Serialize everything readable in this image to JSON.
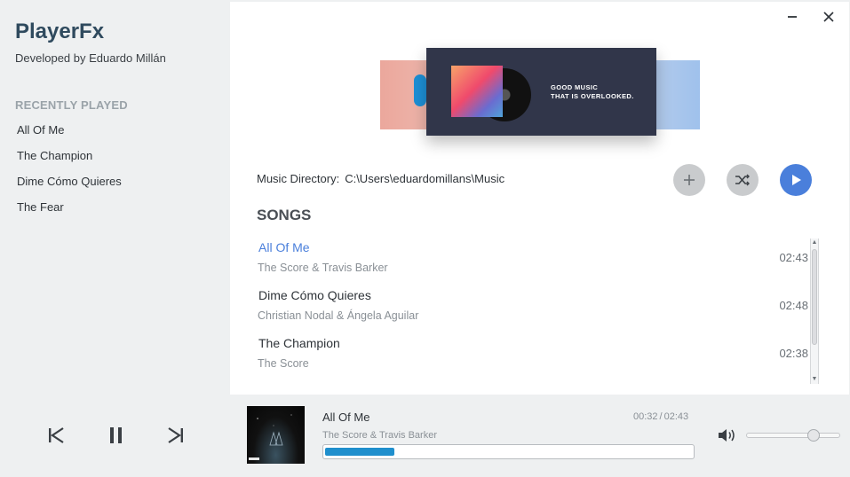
{
  "app": {
    "title": "PlayerFx",
    "subtitle": "Developed by Eduardo Millán"
  },
  "sidebar": {
    "heading": "RECENTLY PLAYED",
    "items": [
      {
        "label": "All Of Me"
      },
      {
        "label": "The Champion"
      },
      {
        "label": "Dime Cómo Quieres"
      },
      {
        "label": "The Fear"
      }
    ]
  },
  "window": {
    "minimize_icon": "minimize-icon",
    "close_icon": "close-icon"
  },
  "banner": {
    "line1": "GOOD MUSIC",
    "line2": "THAT IS OVERLOOKED."
  },
  "directory": {
    "label": "Music Directory:",
    "path": "C:\\Users\\eduardomillans\\Music"
  },
  "actions": {
    "add_icon": "plus-icon",
    "shuffle_icon": "shuffle-icon",
    "play_icon": "play-icon"
  },
  "songs": {
    "heading": "SONGS",
    "items": [
      {
        "title": "All Of Me",
        "artist": "The Score & Travis Barker",
        "duration": "02:43",
        "active": true
      },
      {
        "title": "Dime Cómo Quieres",
        "artist": "Christian Nodal & Ángela Aguilar",
        "duration": "02:48",
        "active": false
      },
      {
        "title": "The Champion",
        "artist": "The Score",
        "duration": "02:38",
        "active": false
      }
    ]
  },
  "player": {
    "title": "All Of Me",
    "artist": "The Score & Travis Barker",
    "elapsed": "00:32",
    "total": "02:43",
    "progress": 0.19,
    "volume": 0.72,
    "accent": "#1f8fcd"
  },
  "colors": {
    "accent": "#4a7fdb",
    "title": "#2f4a5e",
    "progress": "#1f8fcd"
  }
}
